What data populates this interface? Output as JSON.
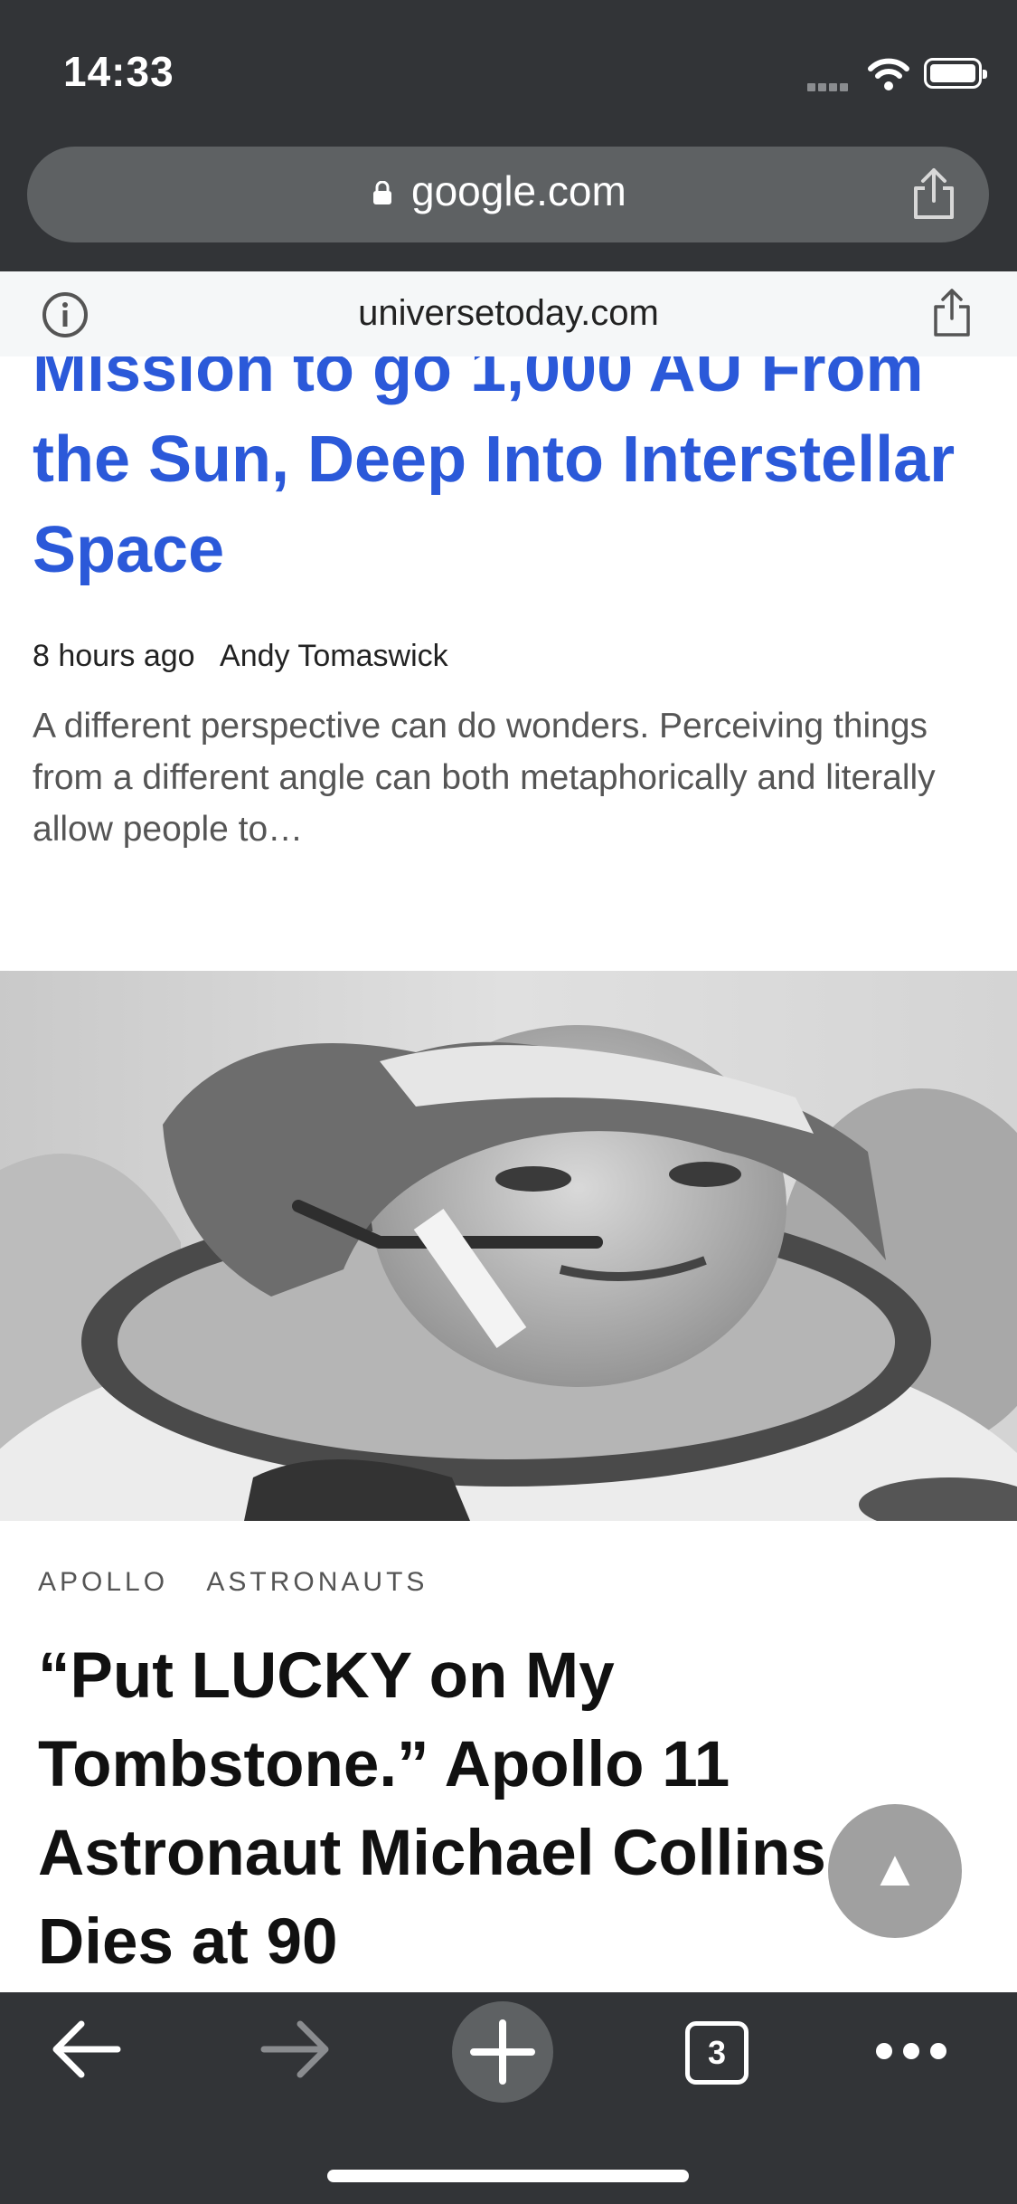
{
  "status_bar": {
    "time": "14:33"
  },
  "url_bar": {
    "domain": "google.com"
  },
  "page_info": {
    "site": "universetoday.com"
  },
  "article1": {
    "title": "Mission to go 1,000 AU From the Sun, Deep Into Interstellar Space",
    "time_ago": "8 hours ago",
    "author": "Andy Tomaswick",
    "excerpt": "A different perspective can do wonders.  Perceiving things from a different angle can both metaphorically and literally allow people to…"
  },
  "article2": {
    "tags": [
      "APOLLO",
      "ASTRONAUTS"
    ],
    "title": "“Put LUCKY on My Tombstone.” Apollo 11 Astronaut Michael Collins Dies at 90"
  },
  "toolbar": {
    "tab_count": "3"
  },
  "icons": [
    "info-icon",
    "share-icon",
    "lock-icon",
    "wifi-icon",
    "battery-icon",
    "back-arrow-icon",
    "forward-arrow-icon",
    "plus-icon",
    "tabs-icon",
    "more-icon",
    "arrow-up-icon"
  ],
  "colors": {
    "chrome": "#323437",
    "link_blue": "#2b59d9",
    "url_pill": "#5e6163"
  }
}
